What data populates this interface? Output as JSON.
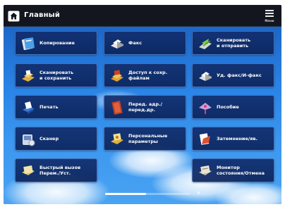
{
  "header": {
    "title": "Главный",
    "menu_label": "Меню"
  },
  "tiles": [
    {
      "label": "Копирование",
      "icon": "copy-icon"
    },
    {
      "label": "Факс",
      "icon": "fax-icon"
    },
    {
      "label": "Сканировать\nи отправить",
      "icon": "scan-send-icon"
    },
    {
      "label": "Сканировать\nи сохранить",
      "icon": "scan-save-icon"
    },
    {
      "label": "Доступ к сохр. файлам",
      "icon": "stored-files-icon"
    },
    {
      "label": "Уд. факс/И-факс",
      "icon": "remote-fax-icon"
    },
    {
      "label": "Печать",
      "icon": "print-icon"
    },
    {
      "label": "Перед. адр./перед.др.",
      "icon": "address-book-icon"
    },
    {
      "label": "Пособие",
      "icon": "tutorial-icon"
    },
    {
      "label": "Сканер",
      "icon": "scanner-icon"
    },
    {
      "label": "Персональные\nпараметры",
      "icon": "personal-settings-icon"
    },
    {
      "label": "Затемнение/яв.",
      "icon": "density-icon"
    },
    {
      "label": "Быстрый вызов\nПерем./Уст.",
      "icon": "quick-menu-icon"
    },
    {
      "label": "Монитор\nсостояния/Отмена",
      "icon": "status-monitor-icon"
    }
  ],
  "pager": {
    "next_symbol": "›",
    "position": 0.45
  },
  "colors": {
    "tile_bg": "#122e6e",
    "tile_border": "#78aaf0",
    "sky_top": "#1c67c8",
    "sky_bottom": "#4aa3f2",
    "topbar_bg": "#13161f"
  }
}
